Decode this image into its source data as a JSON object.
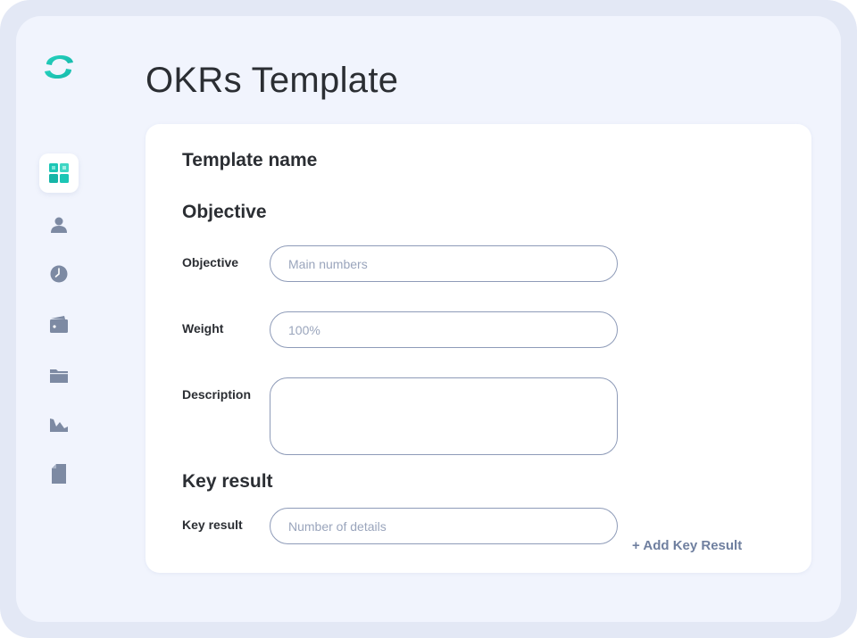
{
  "page": {
    "title": "OKRs Template"
  },
  "sidebar": {
    "items": [
      {
        "name": "dashboard",
        "icon": "dashboard-grid-icon",
        "active": true
      },
      {
        "name": "users",
        "icon": "user-icon",
        "active": false
      },
      {
        "name": "time",
        "icon": "clock-icon",
        "active": false
      },
      {
        "name": "wallet",
        "icon": "wallet-icon",
        "active": false
      },
      {
        "name": "folder",
        "icon": "folder-icon",
        "active": false
      },
      {
        "name": "analytics",
        "icon": "chart-icon",
        "active": false
      },
      {
        "name": "documents",
        "icon": "document-icon",
        "active": false
      }
    ]
  },
  "form": {
    "template_heading": "Template name",
    "objective_heading": "Objective",
    "objective_label": "Objective",
    "objective_placeholder": "Main numbers",
    "weight_label": "Weight",
    "weight_placeholder": "100%",
    "description_label": "Description",
    "description_placeholder": "",
    "key_result_heading": "Key result",
    "key_result_label": "Key result",
    "key_result_placeholder": "Number of details",
    "add_key_result_label": "+ Add Key Result"
  },
  "colors": {
    "accent": "#1cc6b5",
    "icon_gray": "#7d8aa3",
    "text": "#2b2e33",
    "link": "#6f7f9f"
  }
}
